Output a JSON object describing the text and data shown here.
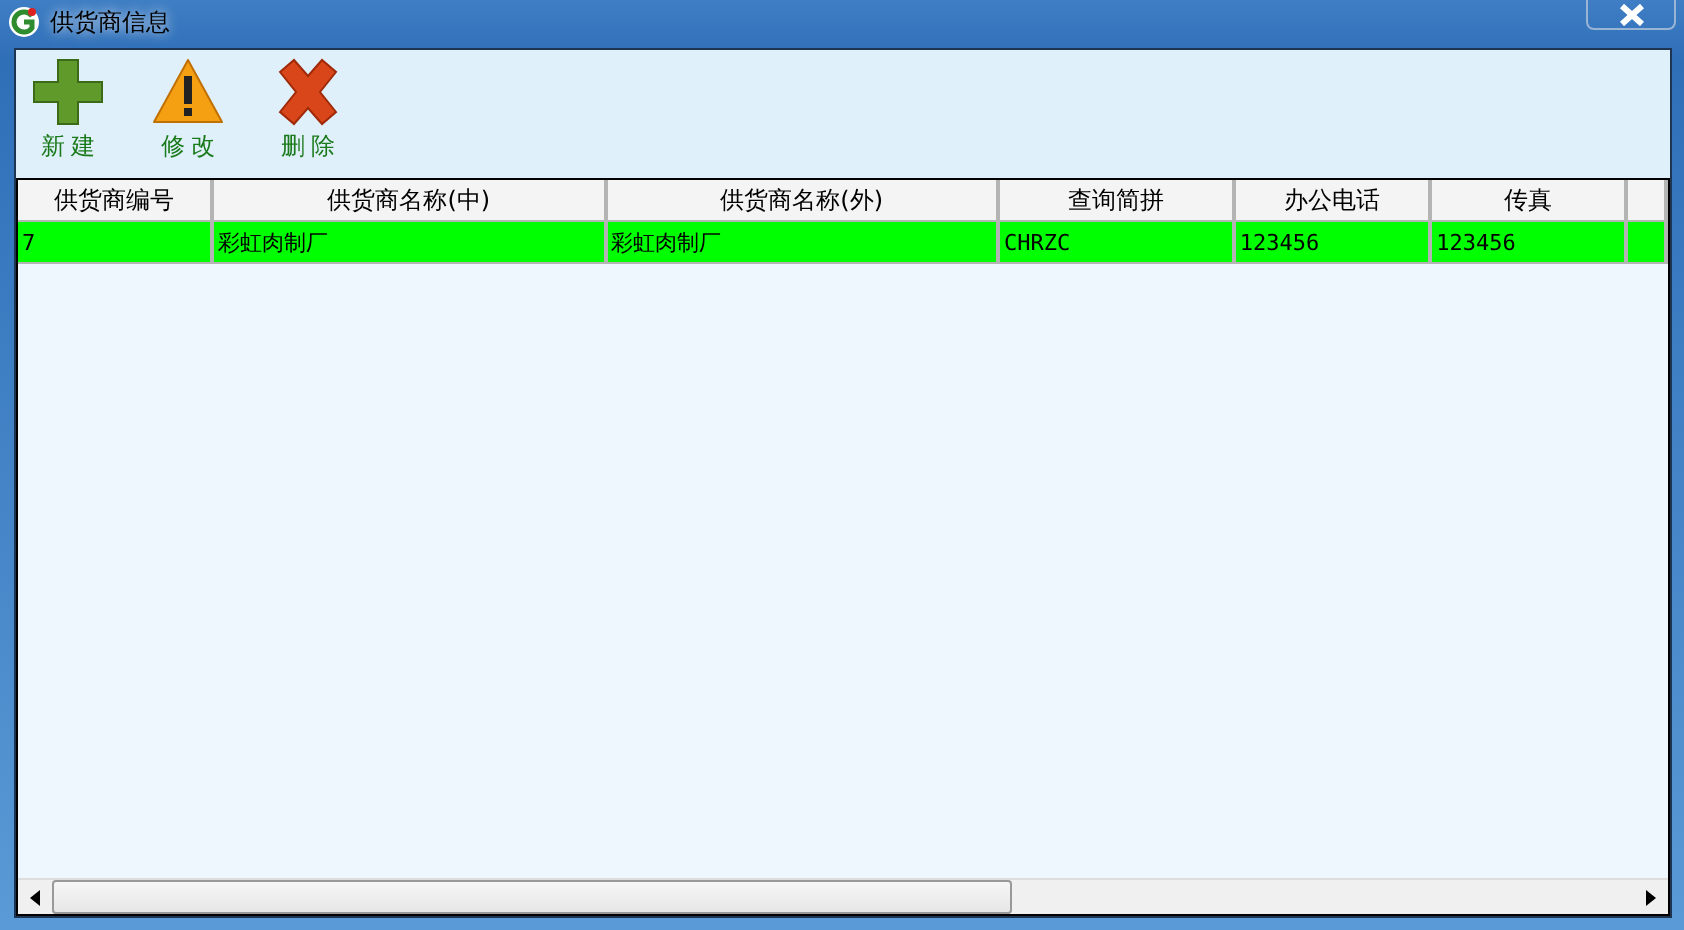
{
  "window": {
    "title": "供货商信息"
  },
  "toolbar": [
    {
      "kind": "add",
      "label": "新 建"
    },
    {
      "kind": "edit",
      "label": "修 改"
    },
    {
      "kind": "delete",
      "label": "删 除"
    }
  ],
  "table": {
    "columns": [
      "供货商编号",
      "供货商名称(中)",
      "供货商名称(外)",
      "查询简拼",
      "办公电话",
      "传真"
    ],
    "rows": [
      {
        "selected": true,
        "cells": [
          "7",
          "彩虹肉制厂",
          "彩虹肉制厂",
          "CHRZC",
          "123456",
          "123456"
        ]
      }
    ]
  }
}
